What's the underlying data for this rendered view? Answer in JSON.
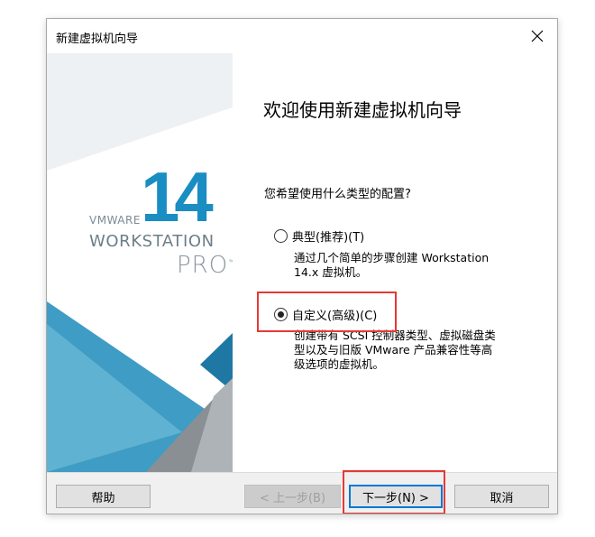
{
  "window": {
    "title": "新建虚拟机向导",
    "close_glyph": "✕"
  },
  "brand": {
    "version": "14",
    "vmware": "VMWARE",
    "product": "WORKSTATION",
    "edition": "PRO",
    "tm": "™"
  },
  "content": {
    "heading": "欢迎使用新建虚拟机向导",
    "question": "您希望使用什么类型的配置?",
    "options": [
      {
        "label": "典型(推荐)(T)",
        "description_lines": [
          "通过几个简单的步骤创建 Workstation",
          "14.x 虚拟机。"
        ],
        "selected": false
      },
      {
        "label": "自定义(高级)(C)",
        "description_lines": [
          "创建带有 SCSI 控制器类型、虚拟磁盘类",
          "型以及与旧版 VMware 产品兼容性等高",
          "级选项的虚拟机。"
        ],
        "selected": true
      }
    ]
  },
  "footer": {
    "help_label": "帮助",
    "back_label": "< 上一步(B)",
    "next_label": "下一步(N) >",
    "cancel_label": "取消"
  },
  "colors": {
    "brand_blue": "#1a8dc2",
    "highlight_red": "#e53935",
    "focus_blue": "#0078d7"
  }
}
